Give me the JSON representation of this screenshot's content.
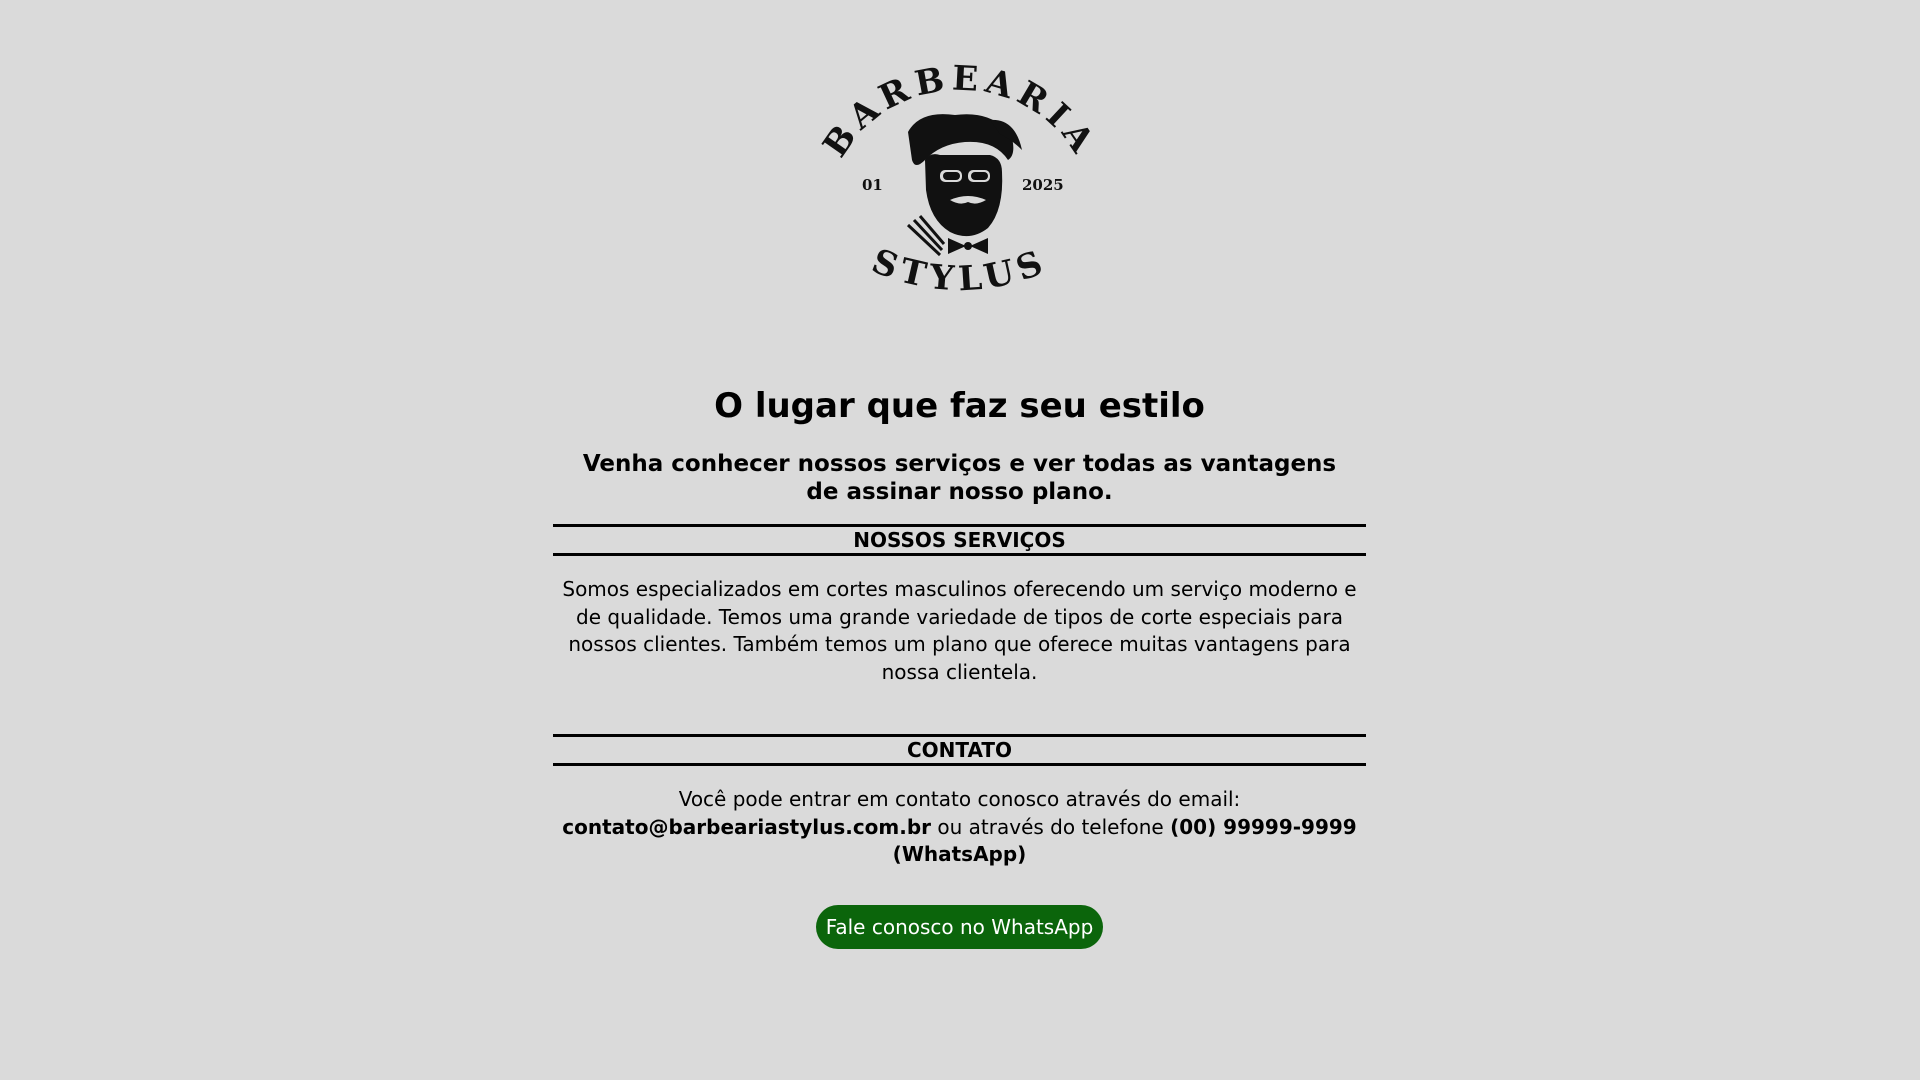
{
  "logo": {
    "top_text": "BARBEARIA",
    "bottom_text": "STYLUS",
    "left_text": "01",
    "right_text": "2025"
  },
  "hero": {
    "title": "O lugar que faz seu estilo",
    "subtitle": "Venha conhecer nossos serviços e ver todas as vantagens de assinar nosso plano."
  },
  "services": {
    "heading": "NOSSOS SERVIÇOS",
    "text": "Somos especializados em cortes masculinos oferecendo um serviço moderno e de qualidade. Temos uma grande variedade de tipos de corte especiais para nossos clientes. Também temos um plano que oferece muitas vantagens para nossa clientela."
  },
  "contact": {
    "heading": "CONTATO",
    "intro": "Você pode entrar em contato conosco através do email:",
    "email": "contato@barbeariastylus.com.br",
    "middle": "ou através do telefone",
    "phone": "(00) 99999-9999 (WhatsApp)",
    "button_label": "Fale conosco no WhatsApp",
    "button_color": "#0b650b"
  }
}
